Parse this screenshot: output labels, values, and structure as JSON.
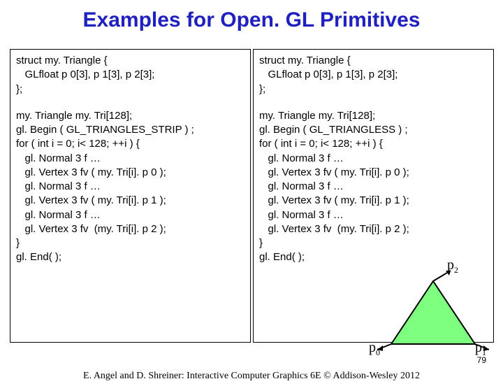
{
  "title": "Examples for Open. GL Primitives",
  "left": {
    "block1": "struct my. Triangle {\n   GLfloat p 0[3], p 1[3], p 2[3];\n};",
    "block2": "my. Triangle my. Tri[128];\ngl. Begin ( GL_TRIANGLES_STRIP ) ;\nfor ( int i = 0; i< 128; ++i ) {\n   gl. Normal 3 f …\n   gl. Vertex 3 fv ( my. Tri[i]. p 0 );\n   gl. Normal 3 f …\n   gl. Vertex 3 fv ( my. Tri[i]. p 1 );\n   gl. Normal 3 f …\n   gl. Vertex 3 fv  (my. Tri[i]. p 2 );\n}\ngl. End( );"
  },
  "right": {
    "block1": "struct my. Triangle {\n   GLfloat p 0[3], p 1[3], p 2[3];\n};",
    "block2": "my. Triangle my. Tri[128];\ngl. Begin ( GL_TRIANGLESS ) ;\nfor ( int i = 0; i< 128; ++i ) {\n   gl. Normal 3 f …\n   gl. Vertex 3 fv ( my. Tri[i]. p 0 );\n   gl. Normal 3 f …\n   gl. Vertex 3 fv ( my. Tri[i]. p 1 );\n   gl. Normal 3 f …\n   gl. Vertex 3 fv  (my. Tri[i]. p 2 );\n}\ngl. End( );"
  },
  "triangle": {
    "p0": "p",
    "p0sub": "0",
    "p1": "p",
    "p1sub": "1",
    "p2": "p",
    "p2sub": "2"
  },
  "pagenum": "79",
  "footer": "E. Angel and D. Shreiner: Interactive Computer Graphics 6E © Addison-Wesley 2012"
}
